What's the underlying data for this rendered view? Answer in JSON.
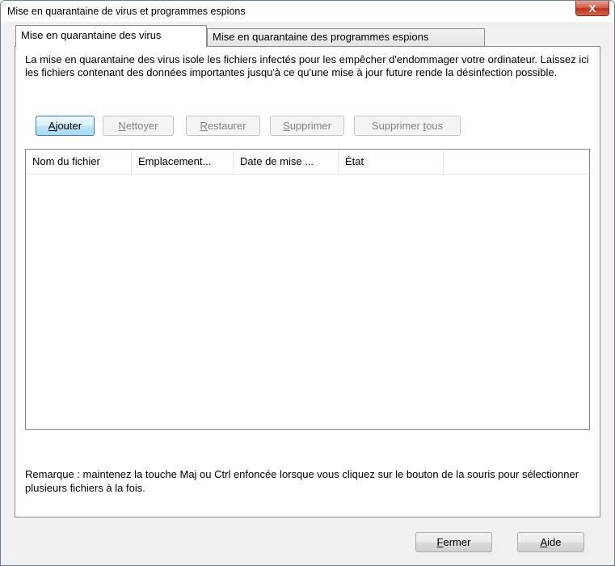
{
  "window": {
    "title": "Mise en quarantaine de virus et programmes espions",
    "close_label": "X"
  },
  "tabs": [
    {
      "label": "Mise en quarantaine des virus",
      "active": true
    },
    {
      "label": "Mise en quarantaine des programmes espions",
      "active": false
    }
  ],
  "panel": {
    "description": "La mise en quarantaine des virus isole les fichiers infectés pour les empêcher d'endommager votre ordinateur. Laissez ici les fichiers contenant des données importantes jusqu'à ce qu'une mise à jour future rende la désinfection possible.",
    "buttons": {
      "add": {
        "pre": "",
        "key": "A",
        "post": "jouter"
      },
      "clean": {
        "pre": "",
        "key": "N",
        "post": "ettoyer"
      },
      "restore": {
        "pre": "",
        "key": "R",
        "post": "estaurer"
      },
      "delete": {
        "pre": "",
        "key": "S",
        "post": "upprimer"
      },
      "delete_all": {
        "pre": "Supprimer ",
        "key": "t",
        "post": "ous"
      }
    },
    "columns": [
      "Nom du fichier",
      "Emplacement...",
      "Date de mise ...",
      "État"
    ],
    "rows": [],
    "note": "Remarque : maintenez la touche Maj ou Ctrl enfoncée lorsque vous cliquez sur le bouton de la souris pour sélectionner plusieurs fichiers à la fois."
  },
  "footer": {
    "close": {
      "key": "F",
      "post": "ermer"
    },
    "help": {
      "key": "A",
      "post": "ide"
    }
  }
}
